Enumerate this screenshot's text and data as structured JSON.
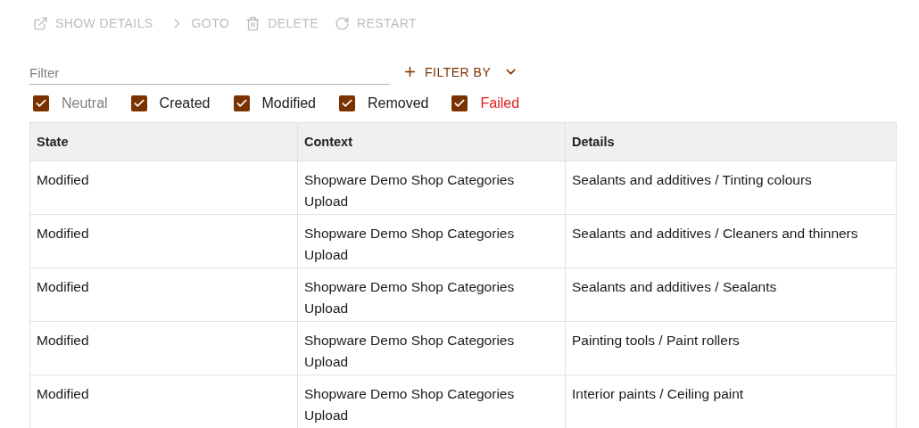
{
  "toolbar": [
    {
      "kind": "external",
      "label": "SHOW DETAILS",
      "disabled": true
    },
    {
      "kind": "chevron",
      "label": "GOTO",
      "disabled": true
    },
    {
      "kind": "trash",
      "label": "DELETE",
      "disabled": true
    },
    {
      "kind": "restart",
      "label": "RESTART",
      "disabled": true
    }
  ],
  "filter": {
    "placeholder": "Filter"
  },
  "filter_by": {
    "label": "FILTER BY"
  },
  "state_filters": [
    {
      "label": "Neutral",
      "checked": true,
      "color": "#808080"
    },
    {
      "label": "Created",
      "checked": true,
      "color": "#1a1a1a"
    },
    {
      "label": "Modified",
      "checked": true,
      "color": "#1a1a1a"
    },
    {
      "label": "Removed",
      "checked": true,
      "color": "#1a1a1a"
    },
    {
      "label": "Failed",
      "checked": true,
      "color": "#e31c1c"
    }
  ],
  "table": {
    "columns": [
      "State",
      "Context",
      "Details"
    ],
    "rows": [
      [
        "Modified",
        "Shopware Demo Shop Categories Upload",
        "Sealants and additives / Tinting colours"
      ],
      [
        "Modified",
        "Shopware Demo Shop Categories Upload",
        "Sealants and additives / Cleaners and thinners"
      ],
      [
        "Modified",
        "Shopware Demo Shop Categories Upload",
        "Sealants and additives / Sealants"
      ],
      [
        "Modified",
        "Shopware Demo Shop Categories Upload",
        "Painting tools / Paint rollers"
      ],
      [
        "Modified",
        "Shopware Demo Shop Categories Upload",
        "Interior paints / Ceiling paint"
      ]
    ]
  }
}
